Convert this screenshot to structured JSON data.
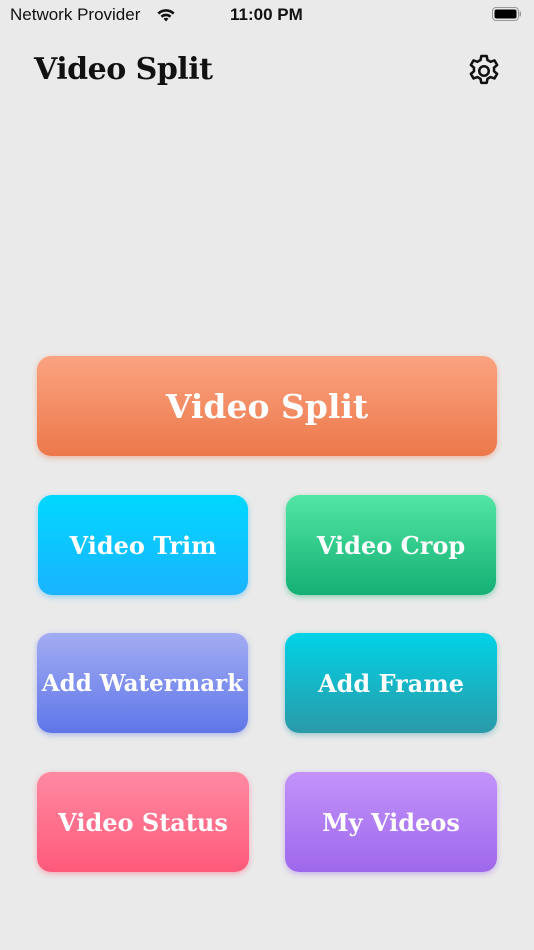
{
  "status_bar": {
    "carrier": "Network Provider",
    "time": "11:00 PM",
    "wifi_icon": "wifi-icon",
    "battery_icon": "battery-full-icon"
  },
  "header": {
    "title": "Video Split",
    "settings_icon": "gear-icon"
  },
  "buttons": {
    "main": {
      "label": "Video Split",
      "colors": [
        "#fba381",
        "#ec784a"
      ]
    },
    "grid": [
      {
        "label": "Video Trim",
        "colors": [
          "#00d8ff",
          "#1ab3ff"
        ]
      },
      {
        "label": "Video Crop",
        "colors": [
          "#52e6a4",
          "#14b074"
        ]
      },
      {
        "label": "Add Watermark",
        "colors": [
          "#a3acf2",
          "#5e76e8"
        ]
      },
      {
        "label": "Add Frame",
        "colors": [
          "#00d3e7",
          "#2a9aa8"
        ]
      },
      {
        "label": "Video Status",
        "colors": [
          "#ff89a2",
          "#ff5a7a"
        ]
      },
      {
        "label": "My Videos",
        "colors": [
          "#c393fa",
          "#9f68ec"
        ]
      }
    ]
  },
  "theme": {
    "background": "#eaeaea"
  }
}
